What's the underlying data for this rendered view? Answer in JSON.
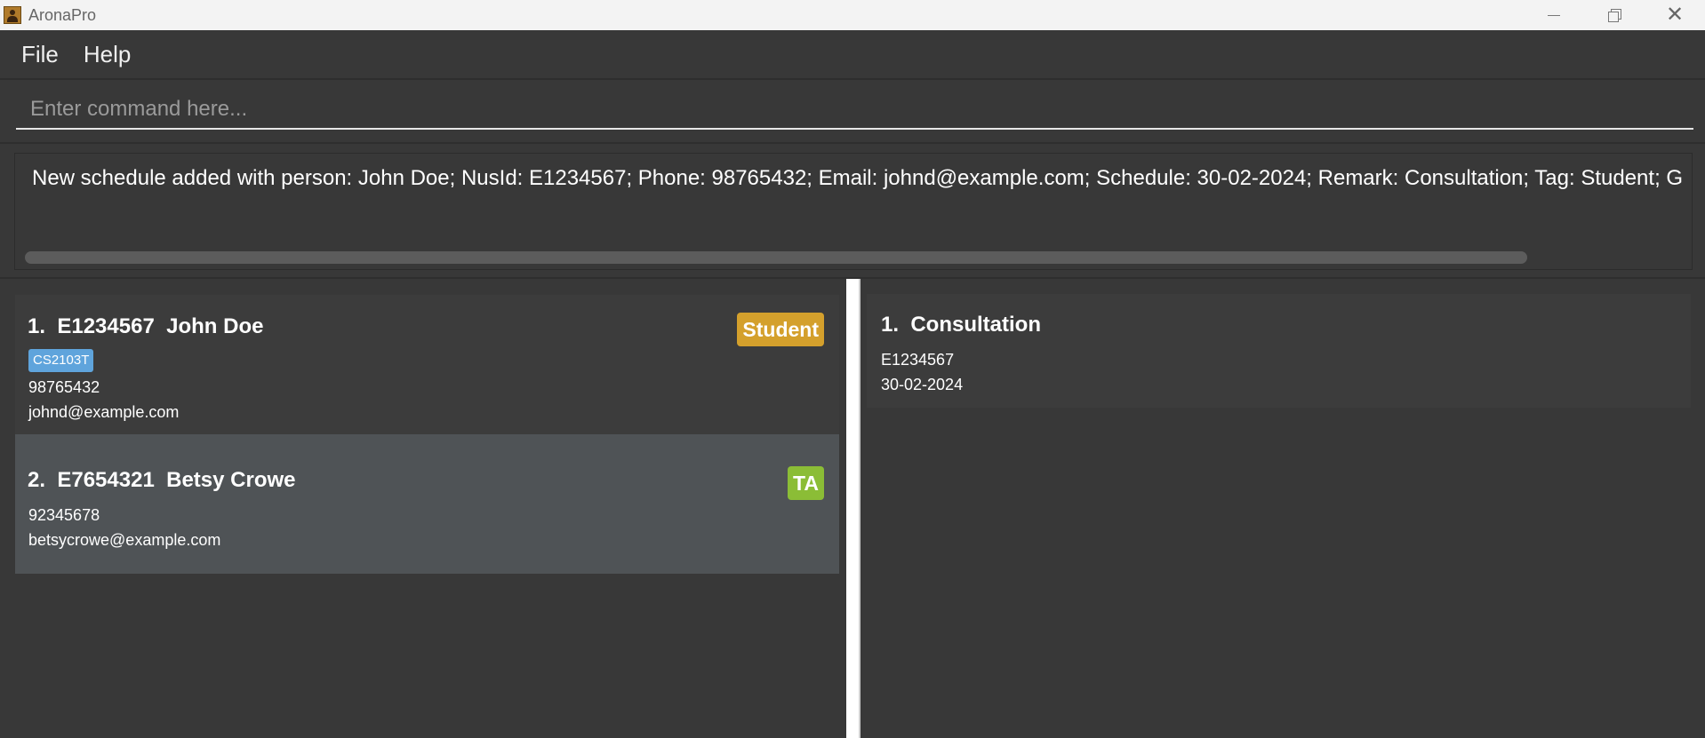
{
  "window": {
    "title": "AronaPro",
    "close_glyph": "✕"
  },
  "menu": {
    "file": "File",
    "help": "Help"
  },
  "command": {
    "placeholder": "Enter command here...",
    "value": ""
  },
  "result": {
    "text": "New schedule added with person: John Doe; NusId: E1234567; Phone: 98765432; Email: johnd@example.com; Schedule: 30-02-2024; Remark: Consultation; Tag: Student; G"
  },
  "persons": [
    {
      "title": "1.  E1234567  John Doe",
      "role": "Student",
      "course": "CS2103T",
      "phone": "98765432",
      "email": "johnd@example.com"
    },
    {
      "title": "2.  E7654321  Betsy Crowe",
      "role": "TA",
      "phone": "92345678",
      "email": "betsycrowe@example.com"
    }
  ],
  "schedules": [
    {
      "title": "1.  Consultation",
      "nusid": "E1234567",
      "date": "30-02-2024"
    }
  ],
  "colors": {
    "background": "#383838",
    "student_badge": "#d4a02c",
    "ta_badge": "#8bbd36",
    "course_tag": "#5fa4dc",
    "selected_card": "#4f5356"
  }
}
